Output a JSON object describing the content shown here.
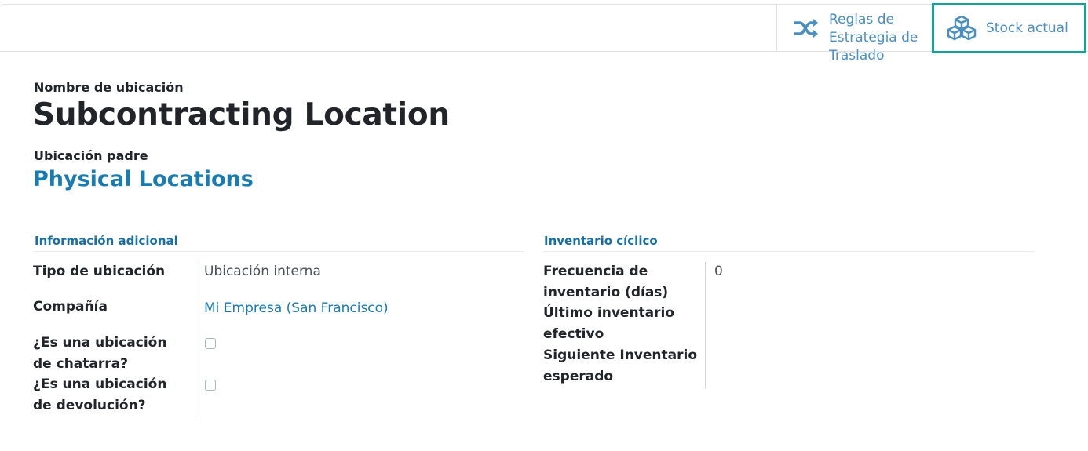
{
  "header": {
    "rules_button_label": [
      "Reglas de",
      "Estrategia de",
      "Traslado"
    ],
    "stock_button_label": "Stock actual",
    "rules_icon": "shuffle-icon",
    "stock_icon": "cubes-icon"
  },
  "location": {
    "name_label": "Nombre de ubicación",
    "name_value": "Subcontracting Location",
    "parent_label": "Ubicación padre",
    "parent_value": "Physical Locations"
  },
  "additional_info": {
    "title": "Información adicional",
    "type_label": "Tipo de ubicación",
    "type_value": "Ubicación interna",
    "company_label": "Compañía",
    "company_value": "Mi Empresa (San Francisco)",
    "scrap_label": [
      "¿Es una ubicación",
      "de chatarra?"
    ],
    "return_label": [
      "¿Es una ubicación",
      "de devolución?"
    ]
  },
  "cyclic_inventory": {
    "title": "Inventario cíclico",
    "frequency_label": [
      "Frecuencia de",
      "inventario (días)"
    ],
    "frequency_value": "0",
    "last_label": [
      "Último inventario",
      "efectivo"
    ],
    "next_label": [
      "Siguiente Inventario",
      "esperado"
    ]
  },
  "colors": {
    "link": "#1a7bb0",
    "accent_border": "#11a29a"
  }
}
